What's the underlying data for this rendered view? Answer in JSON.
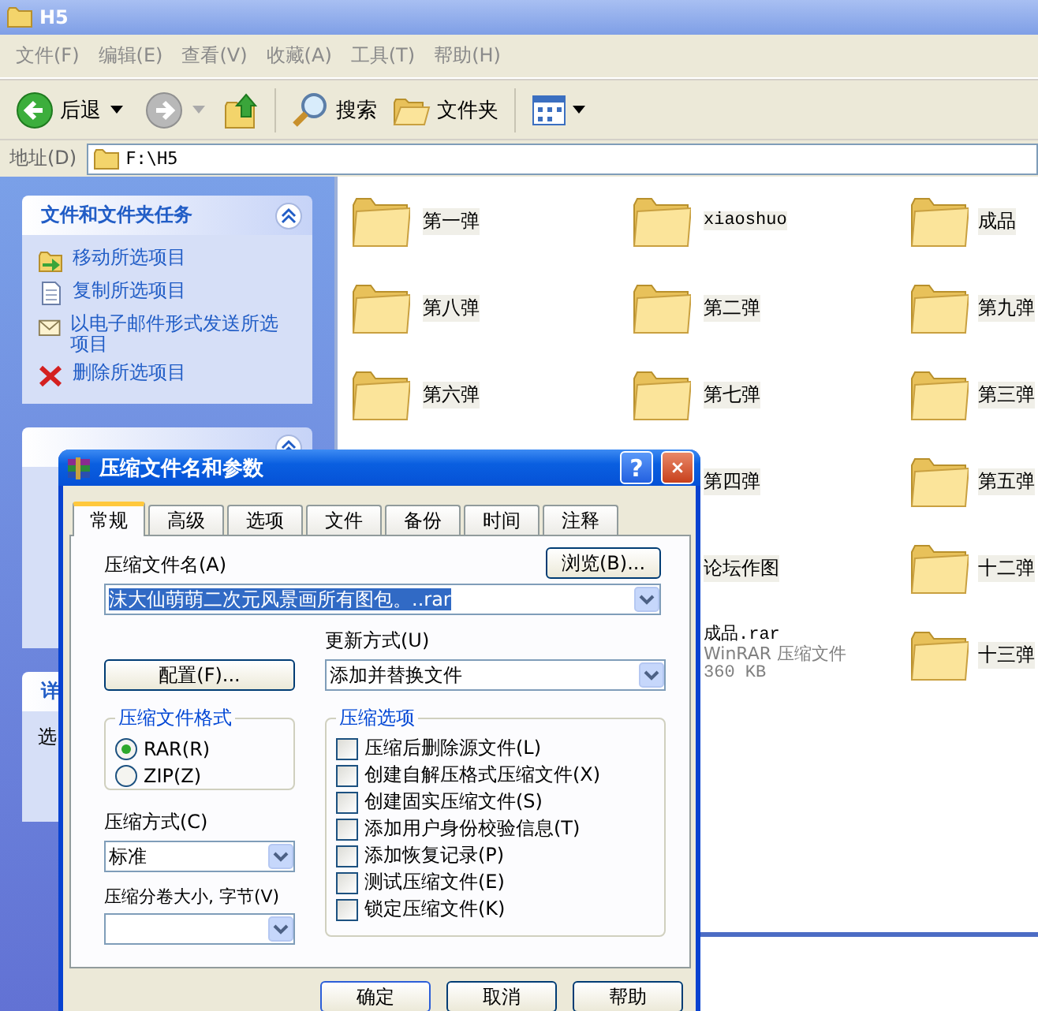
{
  "window": {
    "title": "H5"
  },
  "menu": [
    "文件(F)",
    "编辑(E)",
    "查看(V)",
    "收藏(A)",
    "工具(T)",
    "帮助(H)"
  ],
  "toolbar": {
    "back": "后退",
    "search": "搜索",
    "folders": "文件夹"
  },
  "address": {
    "label": "地址(D)",
    "value": "F:\\H5"
  },
  "task_pane": [
    {
      "kind": "tasks",
      "title": "文件和文件夹任务",
      "items": [
        {
          "kind": "move",
          "label": "移动所选项目"
        },
        {
          "kind": "copy",
          "label": "复制所选项目"
        },
        {
          "kind": "email",
          "label": "以电子邮件形式发送所选项目"
        },
        {
          "kind": "delete",
          "label": "删除所选项目"
        }
      ]
    },
    {
      "kind": "places"
    },
    {
      "kind": "details",
      "title": "详",
      "text": "选"
    }
  ],
  "files": [
    [
      {
        "kind": "folder",
        "name": "第一弹"
      },
      {
        "kind": "folder",
        "name": "xiaoshuo"
      },
      {
        "kind": "folder",
        "name": "成品"
      }
    ],
    [
      {
        "kind": "folder",
        "name": "第八弹"
      },
      {
        "kind": "folder",
        "name": "第二弹"
      },
      {
        "kind": "folder",
        "name": "第九弹"
      }
    ],
    [
      {
        "kind": "folder",
        "name": "第六弹"
      },
      {
        "kind": "folder",
        "name": "第七弹"
      },
      {
        "kind": "folder",
        "name": "第三弹"
      }
    ],
    [
      {
        "kind": "folder",
        "name": "第四弹"
      },
      {
        "kind": "folder",
        "name": "第五弹"
      }
    ],
    [
      {
        "kind": "folder",
        "name": "论坛作图"
      },
      {
        "kind": "folder",
        "name": "十二弹"
      }
    ],
    [
      {
        "kind": "archive",
        "name": "成品.rar",
        "type": "WinRAR 压缩文件",
        "size": "360 KB"
      },
      {
        "kind": "folder",
        "name": "十三弹"
      }
    ]
  ],
  "dialog": {
    "title": "压缩文件名和参数",
    "help_button": "?",
    "tabs": [
      {
        "label": "常规",
        "selected": true
      },
      {
        "label": "高级",
        "selected": false
      },
      {
        "label": "选项",
        "selected": false
      },
      {
        "label": "文件",
        "selected": false
      },
      {
        "label": "备份",
        "selected": false
      },
      {
        "label": "时间",
        "selected": false
      },
      {
        "label": "注释",
        "selected": false
      }
    ],
    "archive_name": {
      "label": "压缩文件名(A)",
      "value": "沫大仙萌萌二次元风景画所有图包。..rar",
      "highlighted": true
    },
    "browse_button": "浏览(B)...",
    "profiles_button": "配置(F)...",
    "update_mode": {
      "label": "更新方式(U)",
      "value": "添加并替换文件"
    },
    "format": {
      "title": "压缩文件格式",
      "options": [
        {
          "label": "RAR(R)",
          "selected": true
        },
        {
          "label": "ZIP(Z)",
          "selected": false
        }
      ]
    },
    "method": {
      "label": "压缩方式(C)",
      "value": "标准"
    },
    "volume": {
      "label": "压缩分卷大小, 字节(V)"
    },
    "options": {
      "title": "压缩选项",
      "items": [
        {
          "label": "压缩后删除源文件(L)",
          "checked": false
        },
        {
          "label": "创建自解压格式压缩文件(X)",
          "checked": false
        },
        {
          "label": "创建固实压缩文件(S)",
          "checked": false
        },
        {
          "label": "添加用户身份校验信息(T)",
          "checked": false
        },
        {
          "label": "添加恢复记录(P)",
          "checked": false
        },
        {
          "label": "测试压缩文件(E)",
          "checked": false
        },
        {
          "label": "锁定压缩文件(K)",
          "checked": false
        }
      ]
    },
    "buttons": [
      "确定",
      "取消",
      "帮助"
    ]
  }
}
